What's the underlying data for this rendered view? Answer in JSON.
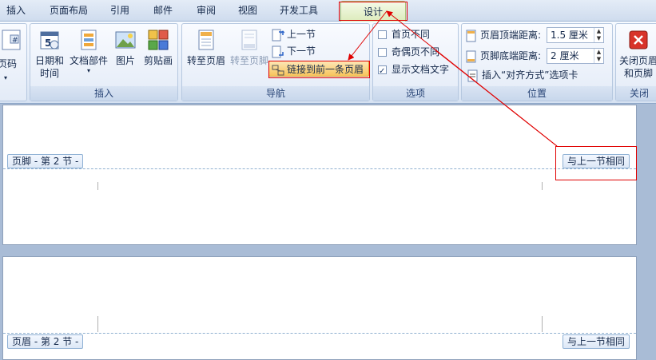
{
  "tabs": [
    {
      "label": "插入"
    },
    {
      "label": "页面布局"
    },
    {
      "label": "引用"
    },
    {
      "label": "邮件"
    },
    {
      "label": "审阅"
    },
    {
      "label": "视图"
    },
    {
      "label": "开发工具"
    },
    {
      "label": "设计"
    }
  ],
  "groups": {
    "insert": {
      "title": "插入",
      "page_number": "页码",
      "date_time": "日期和\n时间",
      "doc_parts": "文档部件",
      "picture": "图片",
      "clipart": "剪贴画"
    },
    "navigation": {
      "title": "导航",
      "goto_header": "转至页眉",
      "goto_footer": "转至页脚",
      "prev_section": "上一节",
      "next_section": "下一节",
      "link_previous": "链接到前一条页眉"
    },
    "options": {
      "title": "选项",
      "first_page": "首页不同",
      "odd_even": "奇偶页不同",
      "show_doc_text": "显示文档文字"
    },
    "position": {
      "title": "位置",
      "header_top_label": "页眉顶端距离:",
      "header_top_value": "1.5 厘米",
      "footer_bottom_label": "页脚底端距离:",
      "footer_bottom_value": "2 厘米",
      "insert_align_tab": "插入“对齐方式”选项卡"
    },
    "close": {
      "title": "关闭",
      "close_btn": "关闭页眉\n和页脚"
    }
  },
  "page1": {
    "footer_tag": "页脚 - 第 2 节 -",
    "same_as_prev": "与上一节相同"
  },
  "page2": {
    "header_tag": "页眉 - 第 2 节 -",
    "same_as_prev": "与上一节相同"
  },
  "colors": {
    "annotation": "#e00000",
    "accent": "#f7c45c"
  }
}
